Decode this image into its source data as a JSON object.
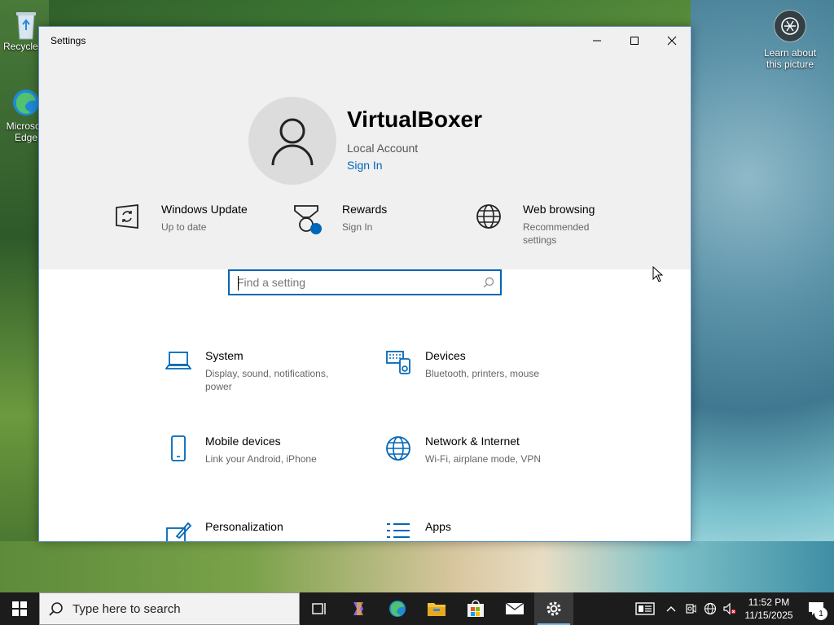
{
  "desktop": {
    "icons": [
      {
        "label": "Recycle Bin"
      },
      {
        "label": "Microsoft Edge"
      }
    ],
    "learn_about": "Learn about this picture"
  },
  "window": {
    "title": "Settings",
    "controls": {
      "minimize": "minimize-icon",
      "maximize": "maximize-icon",
      "close": "close-icon"
    }
  },
  "account": {
    "name": "VirtualBoxer",
    "type": "Local Account",
    "sign_in": "Sign In"
  },
  "quick_links": [
    {
      "title": "Windows Update",
      "subtitle": "Up to date",
      "icon": "windows-update-icon"
    },
    {
      "title": "Rewards",
      "subtitle": "Sign In",
      "icon": "rewards-icon"
    },
    {
      "title": "Web browsing",
      "subtitle": "Recommended settings",
      "icon": "globe-icon"
    }
  ],
  "search": {
    "placeholder": "Find a setting"
  },
  "categories": [
    {
      "title": "System",
      "subtitle": "Display, sound, notifications, power",
      "icon": "laptop-icon"
    },
    {
      "title": "Devices",
      "subtitle": "Bluetooth, printers, mouse",
      "icon": "devices-icon"
    },
    {
      "title": "Mobile devices",
      "subtitle": "Link your Android, iPhone",
      "icon": "phone-icon"
    },
    {
      "title": "Network & Internet",
      "subtitle": "Wi-Fi, airplane mode, VPN",
      "icon": "globe-icon"
    },
    {
      "title": "Personalization",
      "subtitle": "",
      "icon": "personalization-icon"
    },
    {
      "title": "Apps",
      "subtitle": "",
      "icon": "apps-icon"
    }
  ],
  "taskbar": {
    "search_placeholder": "Type here to search",
    "apps": [
      "task-view-icon",
      "copilot-icon",
      "edge-icon",
      "file-explorer-icon",
      "store-icon",
      "mail-icon",
      "settings-icon"
    ],
    "active_app": "settings-icon",
    "time": "11:52 PM",
    "date": "11/15/2025",
    "notification_count": "1"
  },
  "colors": {
    "accent": "#0067b8",
    "taskbar": "#1c1c1c",
    "header_bg": "#f0f0f0"
  }
}
